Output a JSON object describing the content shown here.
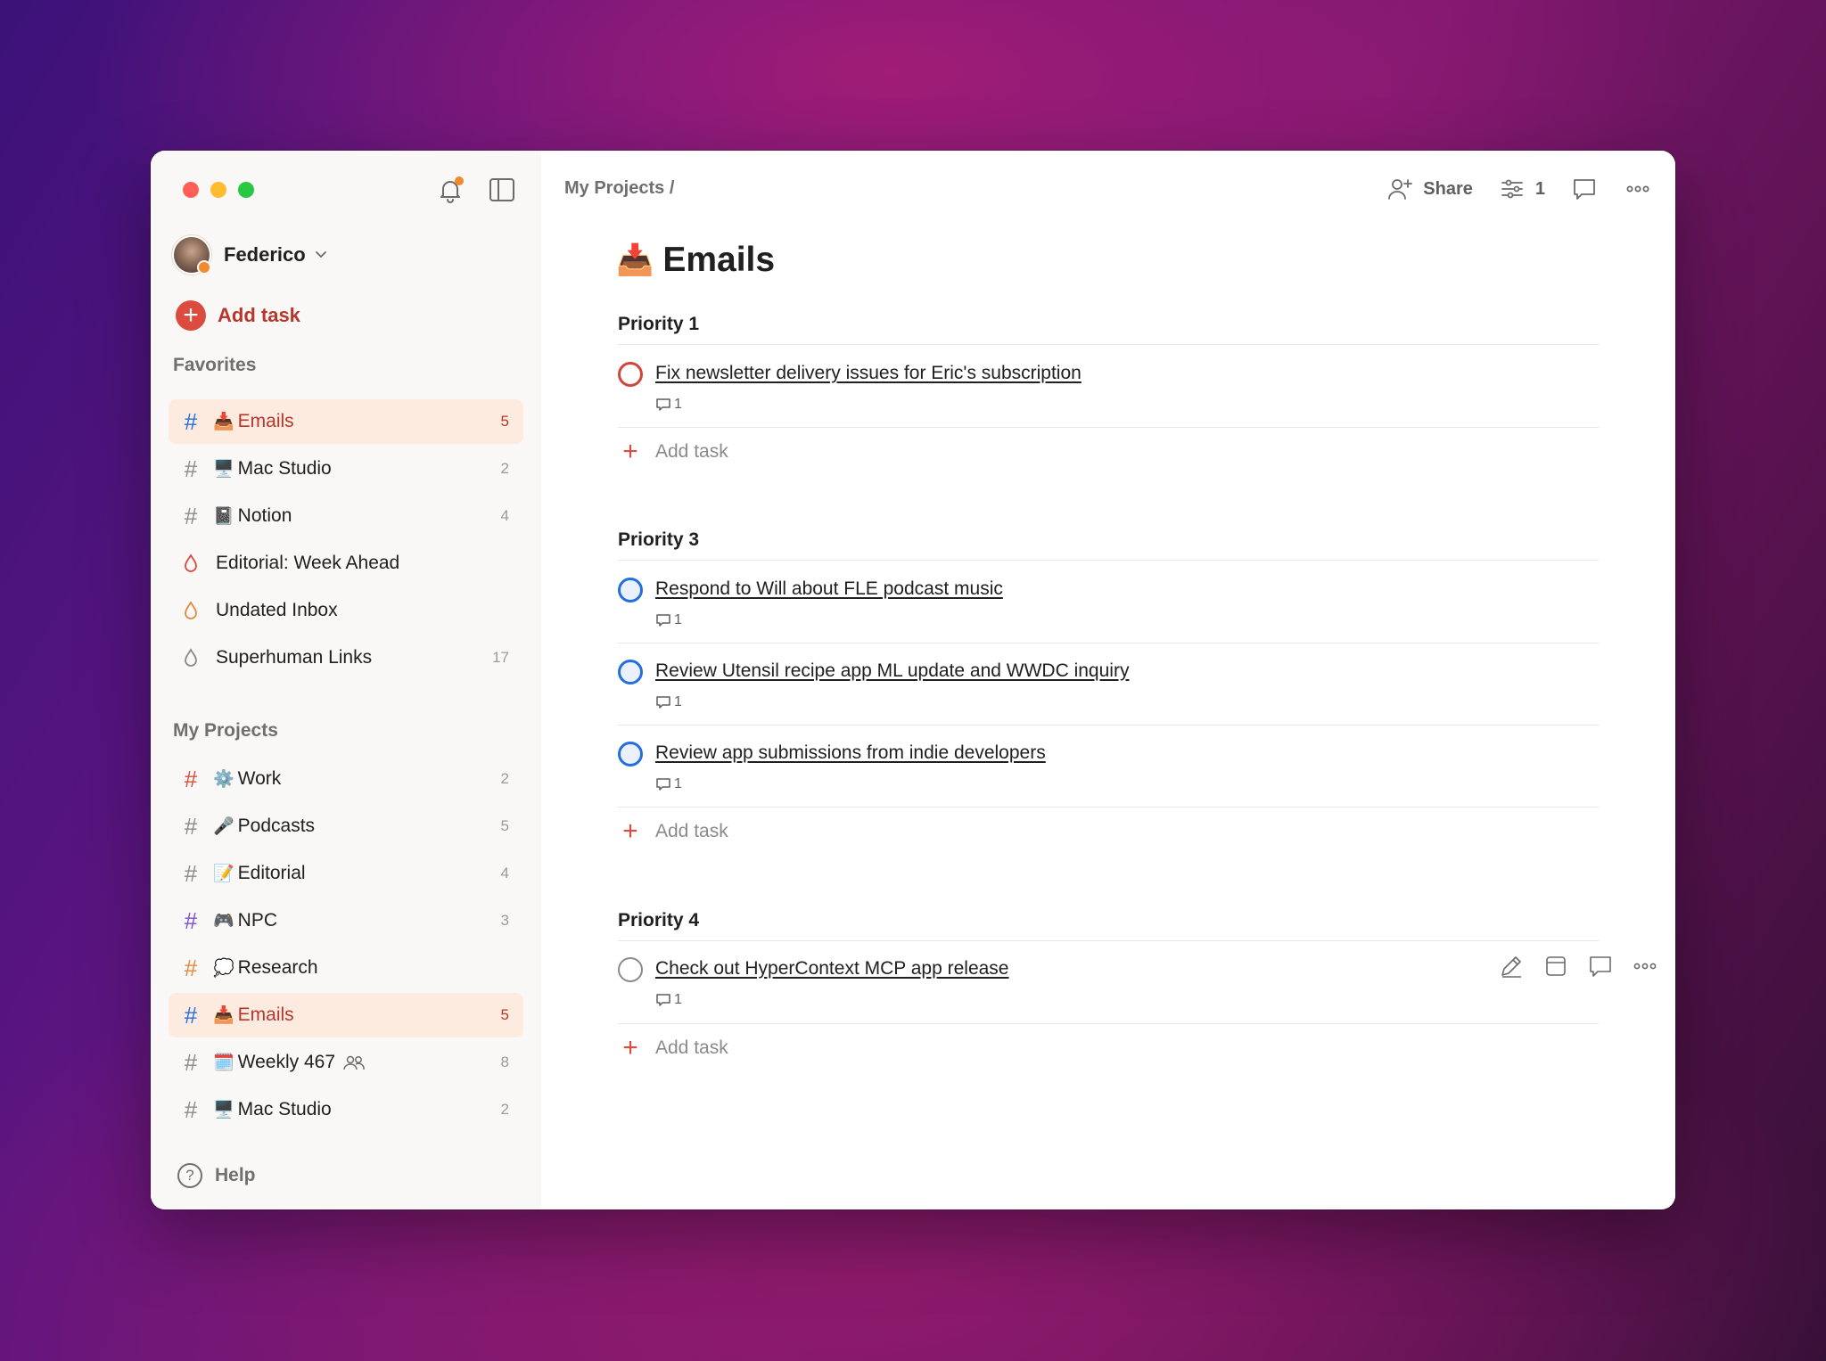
{
  "user": {
    "name": "Federico"
  },
  "sidebar": {
    "add_task_label": "Add task",
    "favorites_header": "Favorites",
    "favorites": [
      {
        "icon": "hash-icon",
        "emoji": "📥",
        "label": "Emails",
        "count": "5",
        "active": true
      },
      {
        "icon": "hash-icon",
        "emoji": "🖥️",
        "label": "Mac Studio",
        "count": "2"
      },
      {
        "icon": "hash-icon",
        "emoji": "📓",
        "label": "Notion",
        "count": "4"
      },
      {
        "icon": "filter-drop-icon",
        "label": "Editorial: Week Ahead",
        "count": ""
      },
      {
        "icon": "filter-drop-icon",
        "label": "Undated Inbox",
        "count": ""
      },
      {
        "icon": "filter-drop-icon",
        "label": "Superhuman Links",
        "count": "17"
      }
    ],
    "projects_header": "My Projects",
    "projects": [
      {
        "icon": "hash-icon",
        "emoji": "⚙️",
        "label": "Work",
        "count": "2"
      },
      {
        "icon": "hash-icon",
        "emoji": "🎤",
        "label": "Podcasts",
        "count": "5"
      },
      {
        "icon": "hash-icon",
        "emoji": "📝",
        "label": "Editorial",
        "count": "4"
      },
      {
        "icon": "hash-icon",
        "emoji": "🎮",
        "label": "NPC",
        "count": "3"
      },
      {
        "icon": "hash-icon",
        "emoji": "💭",
        "label": "Research",
        "count": ""
      },
      {
        "icon": "hash-icon",
        "emoji": "📥",
        "label": "Emails",
        "count": "5",
        "active": true
      },
      {
        "icon": "hash-icon",
        "emoji": "🗓️",
        "label": "Weekly 467",
        "count": "8",
        "shared": true
      },
      {
        "icon": "hash-icon",
        "emoji": "🖥️",
        "label": "Mac Studio",
        "count": "2"
      }
    ],
    "help_label": "Help"
  },
  "header": {
    "breadcrumb": "My Projects /",
    "share_label": "Share",
    "view_count": "1"
  },
  "project": {
    "emoji": "📥",
    "title": "Emails",
    "add_task_label": "Add task",
    "groups": [
      {
        "title": "Priority 1",
        "tasks": [
          {
            "title": "Fix newsletter delivery issues for Eric's subscription",
            "comments": "1",
            "priority": "p1"
          }
        ]
      },
      {
        "title": "Priority 3",
        "tasks": [
          {
            "title": "Respond to Will about FLE podcast music",
            "comments": "1",
            "priority": "p3"
          },
          {
            "title": "Review Utensil recipe app ML update and WWDC inquiry",
            "comments": "1",
            "priority": "p3"
          },
          {
            "title": "Review app submissions from indie developers",
            "comments": "1",
            "priority": "p3"
          }
        ]
      },
      {
        "title": "Priority 4",
        "tasks": [
          {
            "title": "Check out HyperContext MCP app release",
            "comments": "1",
            "priority": "p4"
          }
        ]
      }
    ]
  },
  "colors": {
    "accent": "#dc4c3e",
    "accent_text": "#b8362c",
    "active_bg": "#fdebe0",
    "priority_1": "#d1453b",
    "priority_3": "#246fe0",
    "priority_4": "#8a8a8a",
    "hash_red": "#dc4c3e",
    "hash_blue": "#246fe0",
    "hash_purple": "#7b4fd6",
    "hash_orange": "#e08a3c",
    "hash_gray": "#8a8a8a"
  }
}
